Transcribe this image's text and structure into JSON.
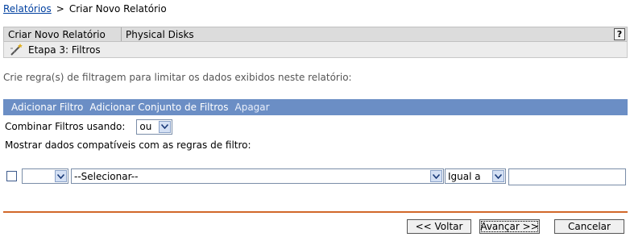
{
  "breadcrumb": {
    "link": "Relatórios",
    "separator": ">",
    "current": "Criar Novo Relatório"
  },
  "header": {
    "title": "Criar Novo Relatório",
    "subtitle": "Physical Disks",
    "help_label": "?"
  },
  "step": {
    "icon": "wizard-wand-icon",
    "label": "Etapa 3: Filtros"
  },
  "instruction": "Crie regra(s) de filtragem para limitar os dados exibidos neste relatório:",
  "actions": {
    "add_filter": "Adicionar Filtro",
    "add_filter_set": "Adicionar Conjunto de Filtros",
    "delete": "Apagar"
  },
  "combine": {
    "label": "Combinar Filtros usando:",
    "value": "ou"
  },
  "show_label": "Mostrar dados compatíveis com as regras de filtro:",
  "filter_row": {
    "checked": false,
    "field_value": "",
    "item_value": "--Selecionar--",
    "operator_value": "Igual a",
    "input_value": ""
  },
  "buttons": {
    "back": "<< Voltar",
    "next": "Avançar >>",
    "cancel": "Cancelar"
  },
  "colors": {
    "action_bar": "#6b8ec5",
    "divider": "#d2682a",
    "link": "#0040a0"
  }
}
